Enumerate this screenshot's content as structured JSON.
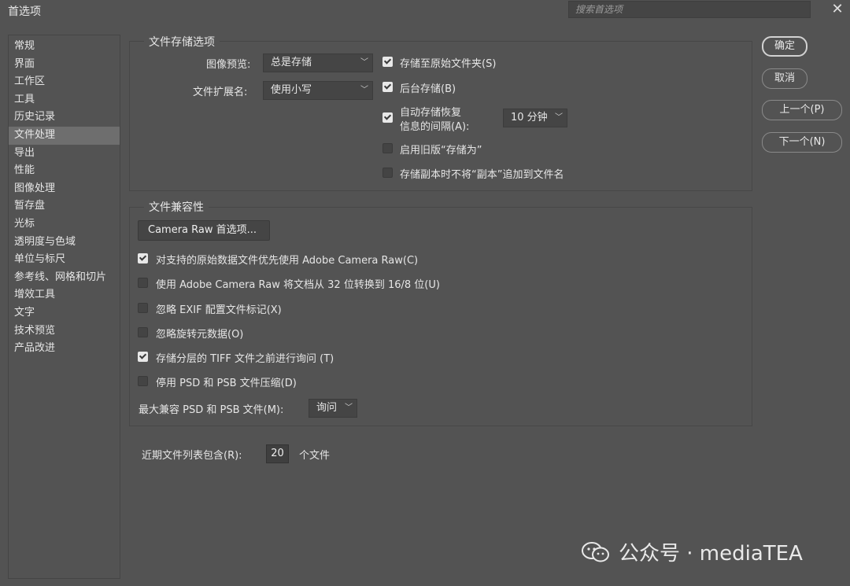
{
  "window": {
    "title": "首选项",
    "search_placeholder": "搜索首选项"
  },
  "sidebar": {
    "items": [
      "常规",
      "界面",
      "工作区",
      "工具",
      "历史记录",
      "文件处理",
      "导出",
      "性能",
      "图像处理",
      "暂存盘",
      "光标",
      "透明度与色域",
      "单位与标尺",
      "参考线、网格和切片",
      "增效工具",
      "文字",
      "技术预览",
      "产品改进"
    ],
    "active_index": 5
  },
  "file_save": {
    "legend": "文件存储选项",
    "image_preview_label": "图像预览:",
    "image_preview_value": "总是存储",
    "file_ext_label": "文件扩展名:",
    "file_ext_value": "使用小写",
    "save_to_original": {
      "label": "存储至原始文件夹(S)",
      "checked": true
    },
    "background_save": {
      "label": "后台存储(B)",
      "checked": true
    },
    "auto_save": {
      "label_line1": "自动存储恢复",
      "label_line2": "信息的间隔(A):",
      "checked": true
    },
    "auto_save_interval": "10 分钟",
    "legacy_save_as": {
      "label": "启用旧版“存储为”",
      "checked": false
    },
    "no_copy_suffix": {
      "label": "存储副本时不将“副本”追加到文件名",
      "checked": false
    }
  },
  "compat": {
    "legend": "文件兼容性",
    "camera_raw_button": "Camera Raw 首选项...",
    "options": [
      {
        "label": "对支持的原始数据文件优先使用 Adobe Camera Raw(C)",
        "checked": true
      },
      {
        "label": "使用 Adobe Camera Raw 将文档从 32 位转换到 16/8 位(U)",
        "checked": false
      },
      {
        "label": "忽略 EXIF 配置文件标记(X)",
        "checked": false
      },
      {
        "label": "忽略旋转元数据(O)",
        "checked": false
      },
      {
        "label": "存储分层的 TIFF 文件之前进行询问 (T)",
        "checked": true
      },
      {
        "label": "停用 PSD 和 PSB 文件压缩(D)",
        "checked": false
      }
    ],
    "max_compat_label": "最大兼容 PSD 和 PSB 文件(M):",
    "max_compat_value": "询问"
  },
  "recent": {
    "label": "近期文件列表包含(R):",
    "value": "20",
    "suffix": "个文件"
  },
  "buttons": {
    "ok": "确定",
    "cancel": "取消",
    "prev": "上一个(P)",
    "next": "下一个(N)"
  },
  "watermark": "公众号 · mediaTEA"
}
